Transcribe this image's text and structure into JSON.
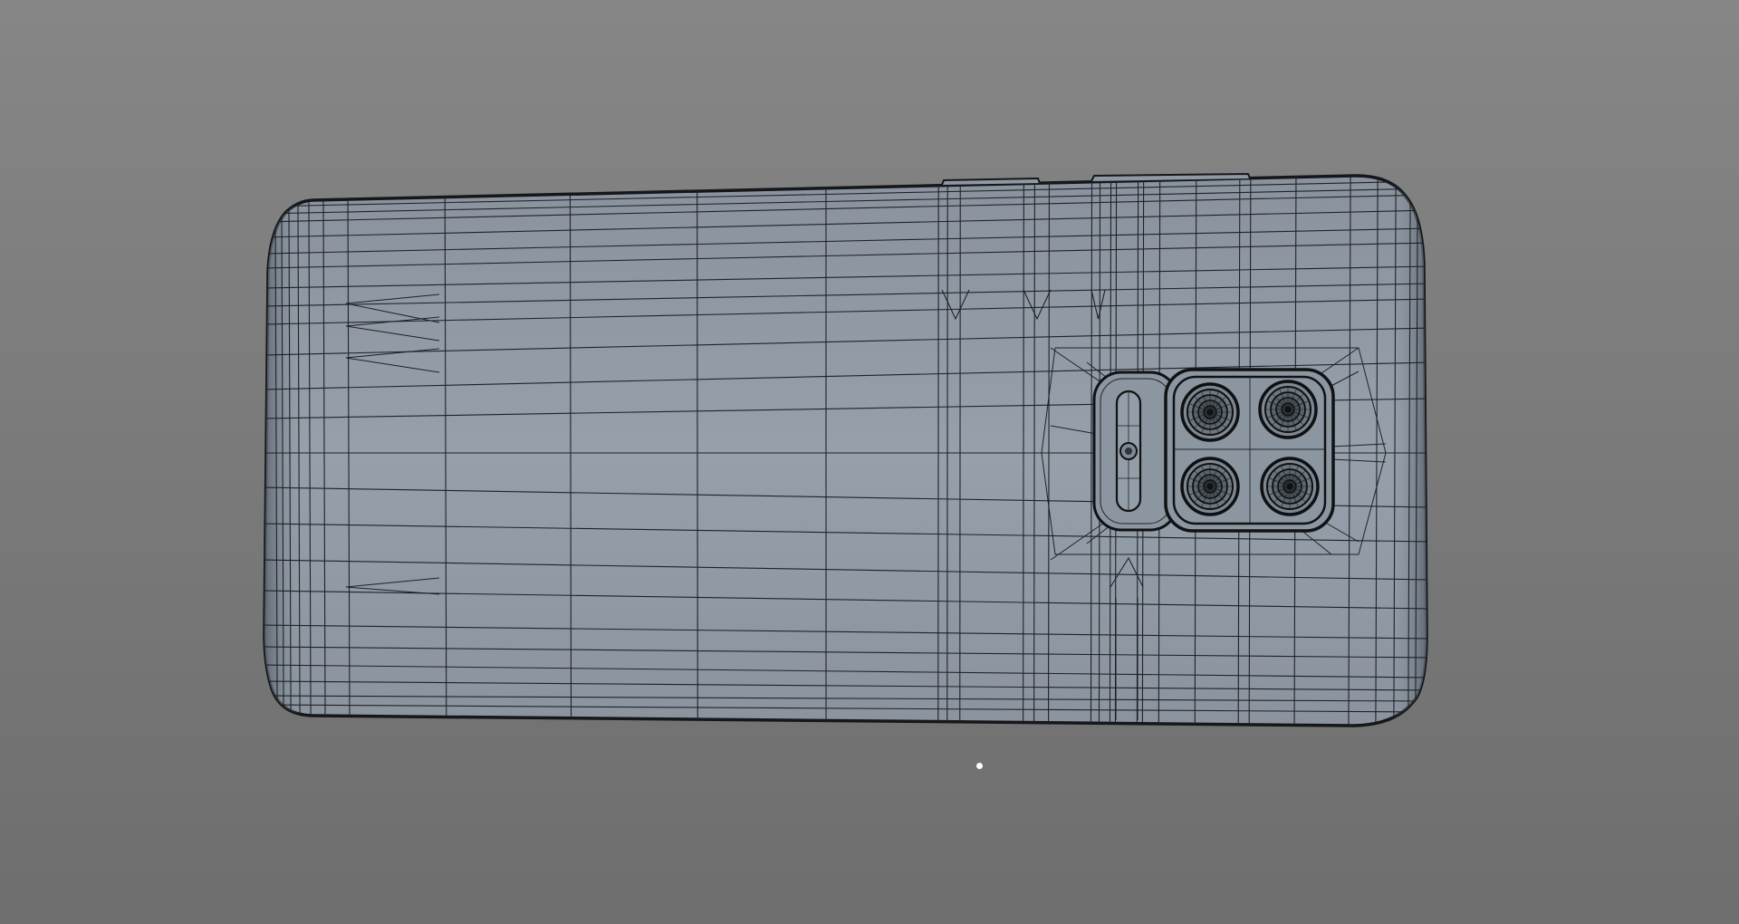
{
  "viewport": {
    "background": "#7c7c7c",
    "mode": "wireframe-on-shaded"
  },
  "model": {
    "object": "smartphone-back",
    "body_color": "#8f9aa4",
    "edge_color": "#1a1c1f",
    "camera_lenses": 4,
    "flash": 1
  },
  "pivot": {
    "color": "#ffffff"
  }
}
